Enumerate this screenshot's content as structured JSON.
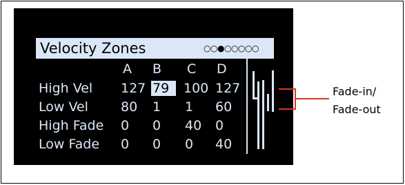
{
  "screen": {
    "title": "Velocity Zones",
    "page_dots": [
      "○",
      "○",
      "●",
      "○",
      "○",
      "○",
      "○",
      "○"
    ],
    "current_page": 3,
    "total_pages": 8,
    "columns": [
      "A",
      "B",
      "C",
      "D"
    ],
    "rows": [
      {
        "label": "High Vel",
        "values": [
          "127",
          "79",
          "100",
          "127"
        ]
      },
      {
        "label": "Low Vel",
        "values": [
          "80",
          "1",
          "1",
          "60"
        ]
      },
      {
        "label": "High Fade",
        "values": [
          "0",
          "0",
          "40",
          "0"
        ]
      },
      {
        "label": "Low Fade",
        "values": [
          "0",
          "0",
          "0",
          "40"
        ]
      }
    ],
    "selected_cell": {
      "row": 0,
      "col": 1
    }
  },
  "callout": {
    "line1": "Fade-in/",
    "line2": "Fade-out"
  },
  "colors": {
    "screen_bg": "#000000",
    "screen_text": "#dbe7f7",
    "callout": "#e03424"
  }
}
